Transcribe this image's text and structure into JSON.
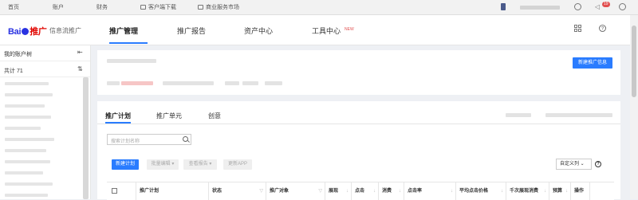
{
  "topbar": {
    "links": [
      "首页",
      "账户",
      "财务",
      "客户端下载",
      "商业服务市场"
    ],
    "badge": "19"
  },
  "header": {
    "logo_text": "Bai",
    "logo_red": "推广",
    "logo_sub": "信息流推广",
    "nav": [
      {
        "label": "推广管理",
        "active": true
      },
      {
        "label": "推广报告"
      },
      {
        "label": "资产中心"
      },
      {
        "label": "工具中心",
        "tag": "NEW"
      }
    ]
  },
  "sidebar": {
    "title": "我的账户树",
    "count": "共计 71"
  },
  "card1": {
    "new_button": "新建推广信息"
  },
  "card2": {
    "tabs": [
      "推广计划",
      "推广单元",
      "创意"
    ],
    "search_placeholder": "搜索计划名称",
    "buttons": {
      "new_plan": "新建计划",
      "batch_edit": "批量编辑",
      "view_report": "查看报告",
      "update_app": "更新APP"
    },
    "custom_columns": "自定义列",
    "help": "?",
    "columns": [
      "推广计划",
      "状态",
      "推广对象",
      "展现",
      "点击",
      "消费",
      "点击率",
      "平均点击价格",
      "千次展现消费",
      "预算",
      "操作"
    ]
  },
  "colors": {
    "accent": "#2a7cff",
    "brand_blue": "#2932e1",
    "brand_red": "#e10601"
  }
}
